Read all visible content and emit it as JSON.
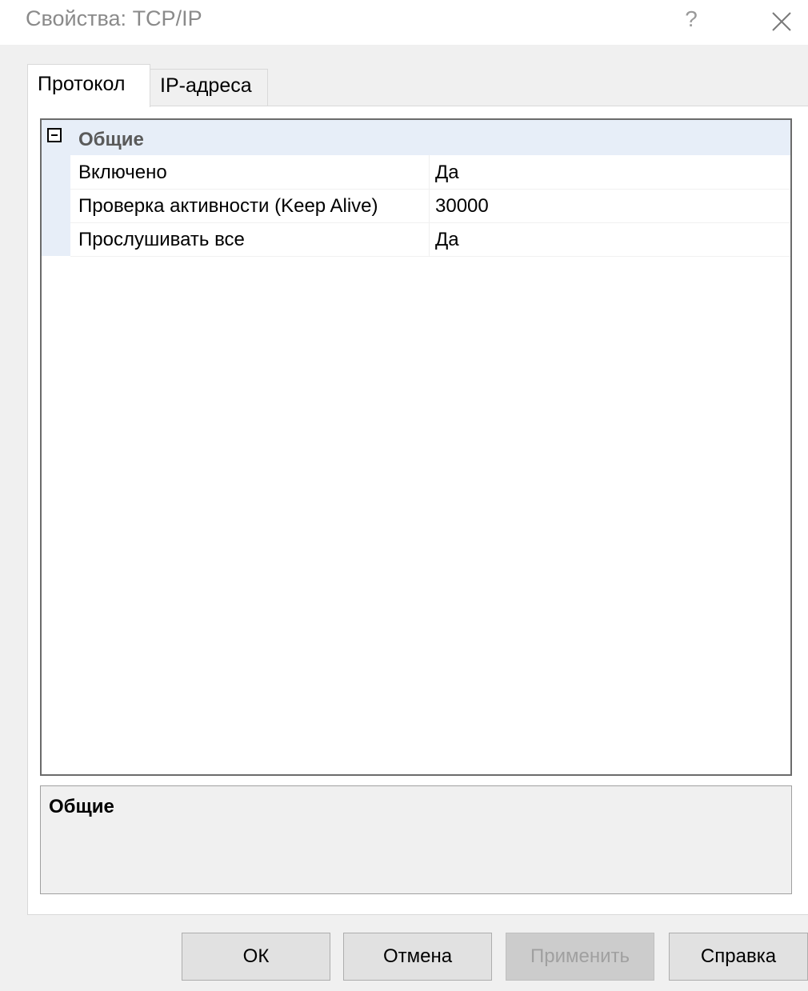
{
  "window": {
    "title": "Свойства: TCP/IP",
    "help_glyph": "?",
    "close_icon": "close-icon"
  },
  "tabs": [
    {
      "label": "Протокол",
      "active": true
    },
    {
      "label": "IP-адреса",
      "active": false
    }
  ],
  "property_grid": {
    "category": {
      "label": "Общие",
      "expanded": true
    },
    "properties": [
      {
        "name": "Включено",
        "value": "Да"
      },
      {
        "name": "Проверка активности (Keep Alive)",
        "value": "30000"
      },
      {
        "name": "Прослушивать все",
        "value": "Да"
      }
    ]
  },
  "description": {
    "title": "Общие"
  },
  "buttons": {
    "ok": "ОК",
    "cancel": "Отмена",
    "apply": "Применить",
    "help": "Справка"
  },
  "colors": {
    "category_background": "#e7eef8",
    "disabled_button": "#cccccc"
  }
}
